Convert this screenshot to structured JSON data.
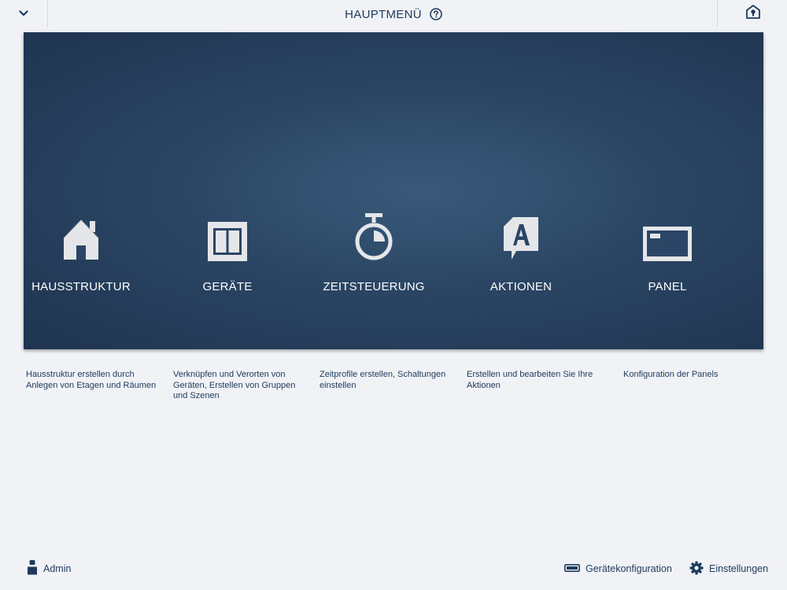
{
  "header": {
    "title": "HAUPTMENÜ",
    "left_icon": "chevron-down-icon",
    "help_icon": "help-icon",
    "right_icon": "house-info-icon"
  },
  "tiles": [
    {
      "label": "HAUSSTRUKTUR",
      "icon": "house-icon",
      "description": "Hausstruktur erstellen durch Anlegen von Etagen und Räumen"
    },
    {
      "label": "GERÄTE",
      "icon": "switch-icon",
      "description": "Verknüpfen und Verorten von Geräten, Erstellen von Gruppen und Szenen"
    },
    {
      "label": "ZEITSTEUERUNG",
      "icon": "timer-icon",
      "description": "Zeitprofile erstellen, Schaltungen einstellen"
    },
    {
      "label": "AKTIONEN",
      "icon": "action-icon",
      "description": "Erstellen und bearbeiten Sie Ihre Aktionen"
    },
    {
      "label": "PANEL",
      "icon": "panel-icon",
      "description": "Konfiguration der Panels"
    }
  ],
  "footer": {
    "user_label": "Admin",
    "device_config_label": "Gerätekonfiguration",
    "settings_label": "Einstellungen"
  },
  "colors": {
    "background": "#f0f2f6",
    "panel_dark": "#1f3451",
    "panel_light": "#3a5a7b",
    "text_dark": "#1d3a5c",
    "icon_light": "#e6e8eb"
  }
}
